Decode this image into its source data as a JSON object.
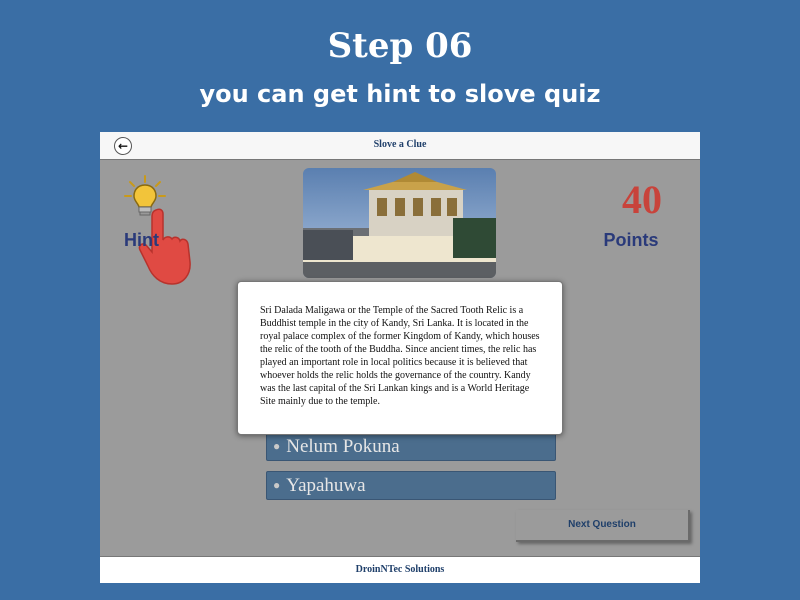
{
  "banner": {
    "title": "Step 06",
    "subtitle": "you can get hint to slove quiz"
  },
  "app": {
    "nav_title": "Slove a Clue",
    "back_icon": "arrow-left-icon",
    "hint_label": "Hint",
    "points_value": "40",
    "points_label": "Points",
    "options": [
      {
        "label": "Nelum Pokuna"
      },
      {
        "label": "Yapahuwa"
      }
    ],
    "next_button": "Next Question",
    "footer": "DroinNTec Solutions",
    "hint_text": "Sri Dalada Maligawa or the Temple of the Sacred Tooth Relic is a Buddhist temple in the city of Kandy, Sri Lanka. It is located in the royal palace complex of the former Kingdom of Kandy, which houses the relic of the tooth of the Buddha. Since ancient times, the relic has played an important role in local politics because it is believed that whoever holds the relic holds the governance of the country. Kandy was the last capital of the Sri Lankan kings and is a World Heritage Site mainly due to the temple."
  },
  "colors": {
    "background": "#3a6ea5",
    "overlay": "#9b9b9b",
    "points": "#c8433b",
    "label": "#2a3a7a",
    "option": "#4b6d8d"
  }
}
